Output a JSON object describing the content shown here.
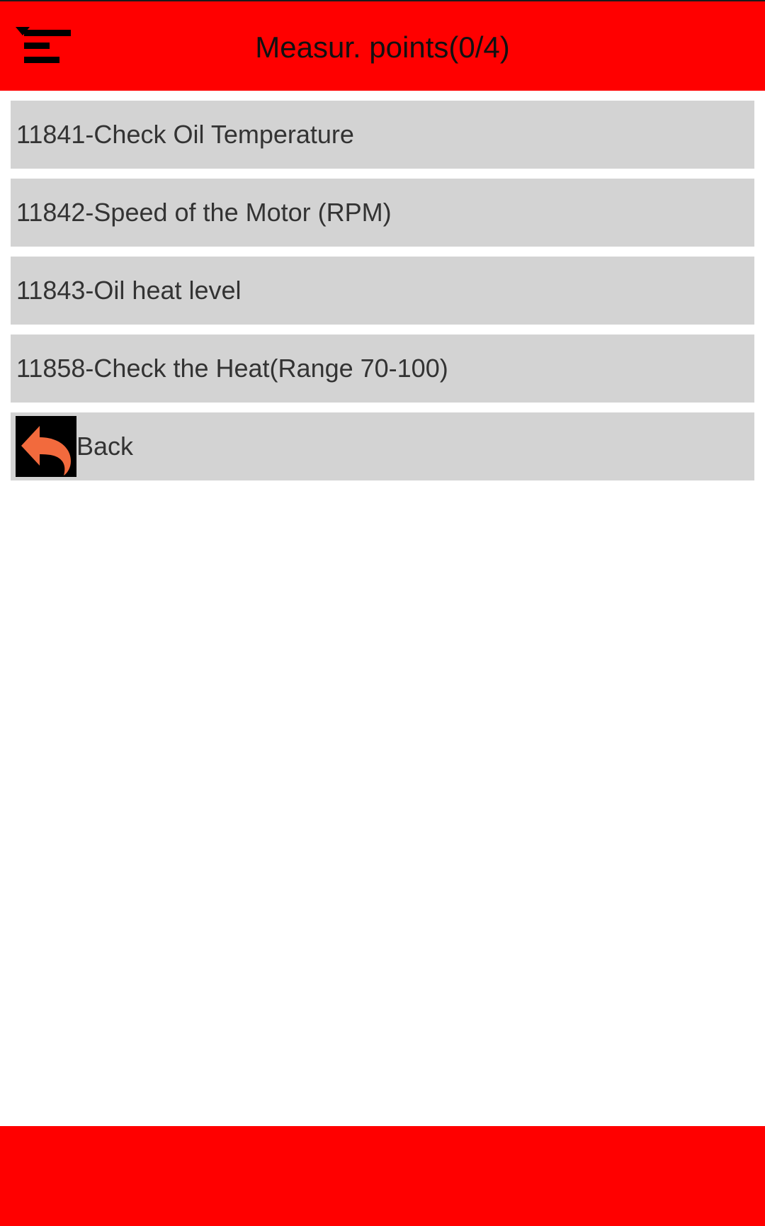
{
  "header": {
    "title": "Measur. points(0/4)"
  },
  "measurement_points": [
    {
      "label": "11841-Check Oil Temperature"
    },
    {
      "label": "11842-Speed of the Motor (RPM)"
    },
    {
      "label": "11843-Oil heat level"
    },
    {
      "label": "11858-Check the Heat(Range 70-100)"
    }
  ],
  "back": {
    "label": "Back"
  },
  "icons": {
    "filter": "filter-menu-icon",
    "back": "back-arrow-icon"
  },
  "colors": {
    "brand_red": "#ff0000",
    "item_bg": "#d3d3d3",
    "text": "#333333",
    "back_arrow": "#f26a3d"
  }
}
